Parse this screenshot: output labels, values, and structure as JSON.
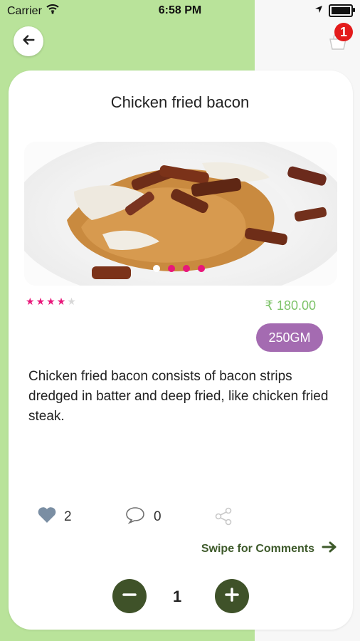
{
  "status": {
    "carrier": "Carrier",
    "time": "6:58 PM"
  },
  "header": {
    "cart_count": "1"
  },
  "product": {
    "title": "Chicken fried bacon",
    "rating": 4,
    "price": "₹ 180.00",
    "weight": "250GM",
    "description": "Chicken fried bacon consists of bacon strips dredged in batter and deep fried, like chicken fried steak."
  },
  "carousel": {
    "dots": 4,
    "active_index": 0
  },
  "social": {
    "likes": "2",
    "comments": "0"
  },
  "swipe": {
    "label": "Swipe for Comments"
  },
  "quantity": {
    "value": "1"
  },
  "colors": {
    "accent_green": "#7ec36a",
    "dark_green": "#3f5229",
    "pink": "#e8177a",
    "purple": "#a46bb1",
    "bg_green": "#b9e39a"
  },
  "icons": [
    "back-arrow-icon",
    "cart-icon",
    "heart-icon",
    "comment-icon",
    "share-icon",
    "arrow-right-icon",
    "minus-icon",
    "plus-icon"
  ]
}
